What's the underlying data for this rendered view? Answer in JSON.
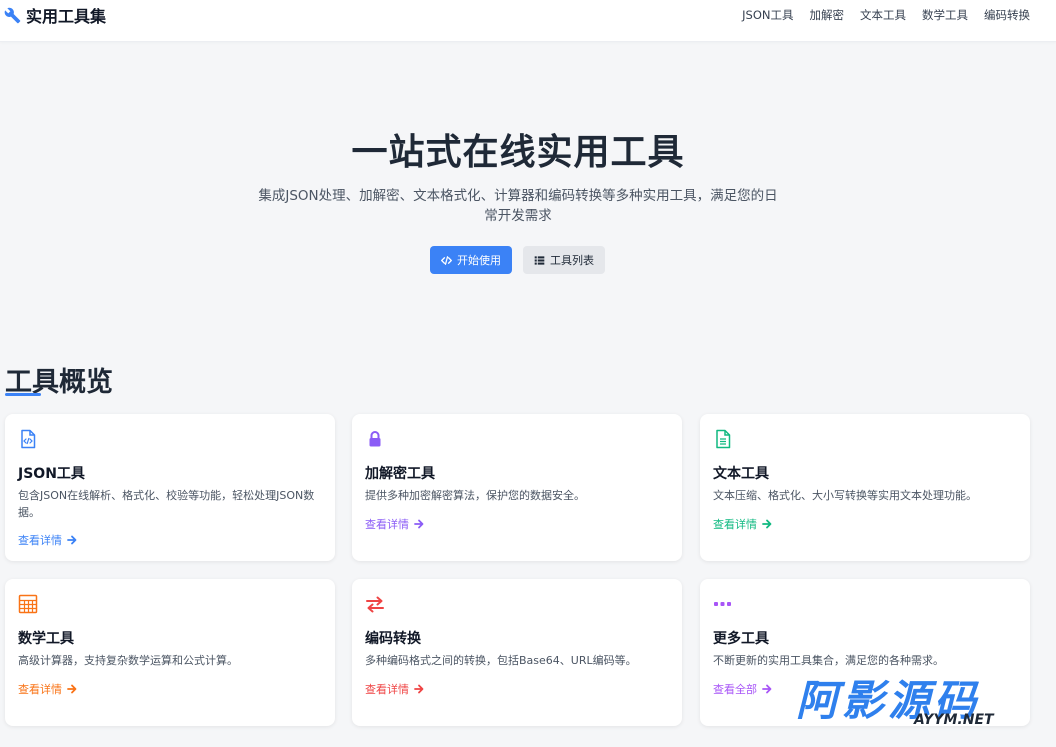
{
  "header": {
    "brand": "实用工具集",
    "nav": [
      "JSON工具",
      "加解密",
      "文本工具",
      "数学工具",
      "编码转换"
    ]
  },
  "hero": {
    "title": "一站式在线实用工具",
    "subtitle": "集成JSON处理、加解密、文本格式化、计算器和编码转换等多种实用工具，满足您的日常开发需求",
    "primary_button": "开始使用",
    "secondary_button": "工具列表"
  },
  "section": {
    "title": "工具概览"
  },
  "cards": [
    {
      "title": "JSON工具",
      "desc": "包含JSON在线解析、格式化、校验等功能，轻松处理JSON数据。",
      "link": "查看详情",
      "color": "#3b82f6",
      "icon": "file-code-icon"
    },
    {
      "title": "加解密工具",
      "desc": "提供多种加密解密算法，保护您的数据安全。",
      "link": "查看详情",
      "color": "#8b5cf6",
      "icon": "lock-icon"
    },
    {
      "title": "文本工具",
      "desc": "文本压缩、格式化、大小写转换等实用文本处理功能。",
      "link": "查看详情",
      "color": "#10b981",
      "icon": "file-text-icon"
    },
    {
      "title": "数学工具",
      "desc": "高级计算器，支持复杂数学运算和公式计算。",
      "link": "查看详情",
      "color": "#f97316",
      "icon": "calculator-icon"
    },
    {
      "title": "编码转换",
      "desc": "多种编码格式之间的转换，包括Base64、URL编码等。",
      "link": "查看详情",
      "color": "#ef4444",
      "icon": "exchange-icon"
    },
    {
      "title": "更多工具",
      "desc": "不断更新的实用工具集合，满足您的各种需求。",
      "link": "查看全部",
      "color": "#a855f7",
      "icon": "ellipsis-icon"
    }
  ],
  "watermark": {
    "main": "阿影源码",
    "sub": "AYYM.NET"
  },
  "colors": {
    "primary": "#3b82f6",
    "background": "#f5f6f8"
  }
}
